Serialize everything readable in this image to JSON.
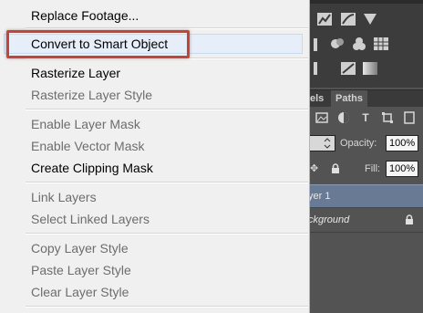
{
  "colors": {
    "menu_bg": "#f0f0f0",
    "menu_text_enabled": "#000000",
    "menu_text_disabled": "#6d6d6d",
    "highlight_annotation": "#c0463c",
    "panel_bg": "#535353",
    "layer_selected": "#687a94"
  },
  "context_menu": {
    "items": [
      {
        "label": "Replace Footage...",
        "enabled": true
      },
      {
        "label": "Convert to Smart Object",
        "enabled": true,
        "highlighted": true
      },
      {
        "label": "Rasterize Layer",
        "enabled": true
      },
      {
        "label": "Rasterize Layer Style",
        "enabled": false
      },
      {
        "label": "Enable Layer Mask",
        "enabled": false
      },
      {
        "label": "Enable Vector Mask",
        "enabled": false
      },
      {
        "label": "Create Clipping Mask",
        "enabled": true
      },
      {
        "label": "Link Layers",
        "enabled": false
      },
      {
        "label": "Select Linked Layers",
        "enabled": false
      },
      {
        "label": "Copy Layer Style",
        "enabled": false
      },
      {
        "label": "Paste Layer Style",
        "enabled": false
      },
      {
        "label": "Clear Layer Style",
        "enabled": false
      }
    ]
  },
  "layers_panel": {
    "tabs": [
      {
        "label": "els"
      },
      {
        "label": "Paths"
      }
    ],
    "toolbar_icons": [
      "image-filter-icon",
      "adjustment-filter-icon",
      "type-filter-icon",
      "shape-filter-icon",
      "smart-object-filter-icon"
    ],
    "opacity_label": "Opacity:",
    "opacity_value": "100%",
    "fill_label": "Fill:",
    "fill_value": "100%",
    "layers": [
      {
        "name": "yer 1",
        "selected": true
      },
      {
        "name": "ckground",
        "selected": false,
        "locked": true
      }
    ]
  }
}
